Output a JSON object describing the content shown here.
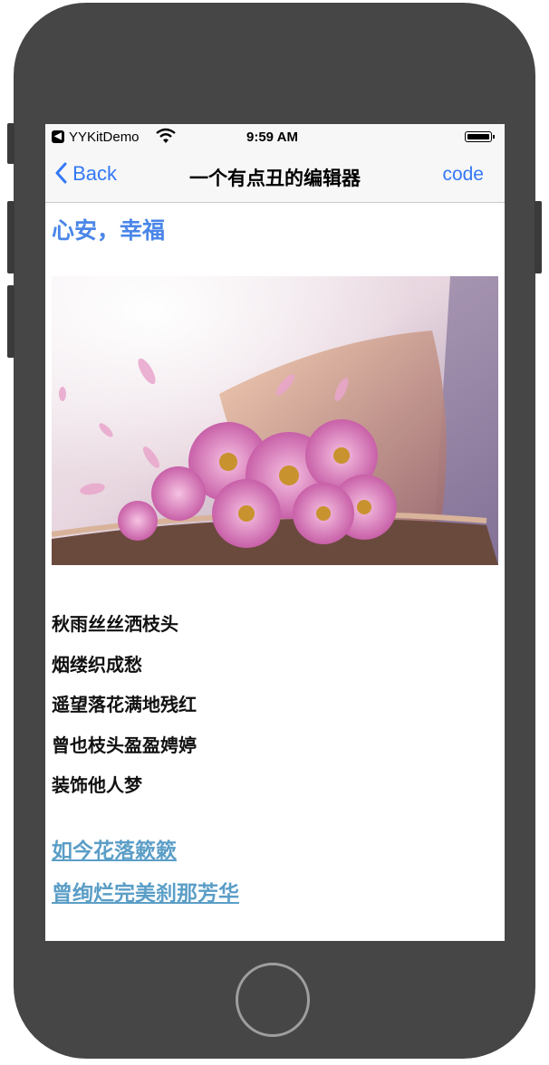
{
  "status_bar": {
    "app_name": "YYKitDemo",
    "back_glyph": "◀",
    "time": "9:59 AM"
  },
  "nav": {
    "back_label": "Back",
    "title": "一个有点丑的编辑器",
    "code_label": "code"
  },
  "content": {
    "heading": "心安，幸福",
    "image": "pink-daisies-on-open-book",
    "poem_lines": [
      "秋雨丝丝洒枝头",
      "烟缕织成愁",
      "遥望落花满地残红",
      "曾也枝头盈盈娉婷",
      "装饰他人梦"
    ],
    "links": [
      "如今花落簌簌",
      "曾绚烂完美刹那芳华"
    ]
  },
  "colors": {
    "accent": "#3478f6",
    "heading": "#4a86e8",
    "link": "#5b9ec7",
    "frame": "#464646"
  }
}
